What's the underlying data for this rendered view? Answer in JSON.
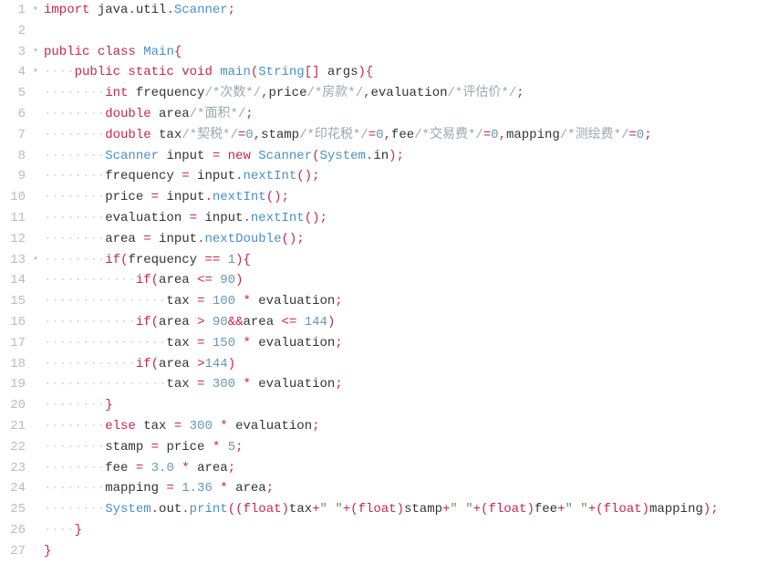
{
  "lines": [
    {
      "n": "1",
      "fold": "▾",
      "indent": 0,
      "tokens": [
        [
          "kw",
          "import"
        ],
        [
          "id",
          " java"
        ],
        [
          "op",
          "."
        ],
        [
          "id",
          "util"
        ],
        [
          "op",
          "."
        ],
        [
          "type",
          "Scanner"
        ],
        [
          "op",
          ";"
        ]
      ]
    },
    {
      "n": "2",
      "fold": "",
      "indent": 0,
      "tokens": []
    },
    {
      "n": "3",
      "fold": "▾",
      "indent": 0,
      "tokens": [
        [
          "kw",
          "public "
        ],
        [
          "kw",
          "class "
        ],
        [
          "type",
          "Main"
        ],
        [
          "op",
          "{"
        ]
      ]
    },
    {
      "n": "4",
      "fold": "▾",
      "indent": 1,
      "tokens": [
        [
          "kw",
          "public "
        ],
        [
          "kw",
          "static "
        ],
        [
          "kw",
          "void "
        ],
        [
          "func",
          "main"
        ],
        [
          "op",
          "("
        ],
        [
          "type",
          "String"
        ],
        [
          "op",
          "[] "
        ],
        [
          "id",
          "args"
        ],
        [
          "op",
          ")"
        ],
        [
          "op",
          "{"
        ]
      ]
    },
    {
      "n": "5",
      "fold": "",
      "indent": 2,
      "tokens": [
        [
          "kw",
          "int "
        ],
        [
          "id",
          "frequency"
        ],
        [
          "cmt",
          "/*次数*/"
        ],
        [
          "op",
          ","
        ],
        [
          "id",
          "price"
        ],
        [
          "cmt",
          "/*房款*/"
        ],
        [
          "op",
          ","
        ],
        [
          "id",
          "evaluation"
        ],
        [
          "cmt",
          "/*评估价*/"
        ],
        [
          "op",
          ";"
        ]
      ]
    },
    {
      "n": "6",
      "fold": "",
      "indent": 2,
      "tokens": [
        [
          "kw",
          "double "
        ],
        [
          "id",
          "area"
        ],
        [
          "cmt",
          "/*面积*/"
        ],
        [
          "op",
          ";"
        ]
      ]
    },
    {
      "n": "7",
      "fold": "",
      "indent": 2,
      "tokens": [
        [
          "kw",
          "double "
        ],
        [
          "id",
          "tax"
        ],
        [
          "cmt",
          "/*契税*/"
        ],
        [
          "op",
          "="
        ],
        [
          "num",
          "0"
        ],
        [
          "op",
          ","
        ],
        [
          "id",
          "stamp"
        ],
        [
          "cmt",
          "/*印花税*/"
        ],
        [
          "op",
          "="
        ],
        [
          "num",
          "0"
        ],
        [
          "op",
          ","
        ],
        [
          "id",
          "fee"
        ],
        [
          "cmt",
          "/*交易费*/"
        ],
        [
          "op",
          "="
        ],
        [
          "num",
          "0"
        ],
        [
          "op",
          ","
        ],
        [
          "id",
          "mapping"
        ],
        [
          "cmt",
          "/*测绘费*/"
        ],
        [
          "op",
          "="
        ],
        [
          "num",
          "0"
        ],
        [
          "op",
          ";"
        ]
      ]
    },
    {
      "n": "8",
      "fold": "",
      "indent": 2,
      "tokens": [
        [
          "type",
          "Scanner "
        ],
        [
          "id",
          "input "
        ],
        [
          "op",
          "= "
        ],
        [
          "kw",
          "new "
        ],
        [
          "type",
          "Scanner"
        ],
        [
          "op",
          "("
        ],
        [
          "type",
          "System"
        ],
        [
          "op",
          "."
        ],
        [
          "id",
          "in"
        ],
        [
          "op",
          ")"
        ],
        [
          "op",
          ";"
        ]
      ]
    },
    {
      "n": "9",
      "fold": "",
      "indent": 2,
      "tokens": [
        [
          "id",
          "frequency "
        ],
        [
          "op",
          "= "
        ],
        [
          "id",
          "input"
        ],
        [
          "op",
          "."
        ],
        [
          "func",
          "nextInt"
        ],
        [
          "op",
          "()"
        ],
        [
          "op",
          ";"
        ]
      ]
    },
    {
      "n": "10",
      "fold": "",
      "indent": 2,
      "tokens": [
        [
          "id",
          "price "
        ],
        [
          "op",
          "= "
        ],
        [
          "id",
          "input"
        ],
        [
          "op",
          "."
        ],
        [
          "func",
          "nextInt"
        ],
        [
          "op",
          "()"
        ],
        [
          "op",
          ";"
        ]
      ]
    },
    {
      "n": "11",
      "fold": "",
      "indent": 2,
      "tokens": [
        [
          "id",
          "evaluation "
        ],
        [
          "op",
          "= "
        ],
        [
          "id",
          "input"
        ],
        [
          "op",
          "."
        ],
        [
          "func",
          "nextInt"
        ],
        [
          "op",
          "()"
        ],
        [
          "op",
          ";"
        ]
      ]
    },
    {
      "n": "12",
      "fold": "",
      "indent": 2,
      "tokens": [
        [
          "id",
          "area "
        ],
        [
          "op",
          "= "
        ],
        [
          "id",
          "input"
        ],
        [
          "op",
          "."
        ],
        [
          "func",
          "nextDouble"
        ],
        [
          "op",
          "()"
        ],
        [
          "op",
          ";"
        ]
      ]
    },
    {
      "n": "13",
      "fold": "▾",
      "indent": 2,
      "tokens": [
        [
          "kw",
          "if"
        ],
        [
          "op",
          "("
        ],
        [
          "id",
          "frequency "
        ],
        [
          "op",
          "== "
        ],
        [
          "num",
          "1"
        ],
        [
          "op",
          ")"
        ],
        [
          "op",
          "{"
        ]
      ]
    },
    {
      "n": "14",
      "fold": "",
      "indent": 3,
      "tokens": [
        [
          "kw",
          "if"
        ],
        [
          "op",
          "("
        ],
        [
          "id",
          "area "
        ],
        [
          "op",
          "<= "
        ],
        [
          "num",
          "90"
        ],
        [
          "op",
          ")"
        ]
      ]
    },
    {
      "n": "15",
      "fold": "",
      "indent": 4,
      "tokens": [
        [
          "id",
          "tax "
        ],
        [
          "op",
          "= "
        ],
        [
          "num",
          "100"
        ],
        [
          "op",
          " * "
        ],
        [
          "id",
          "evaluation"
        ],
        [
          "op",
          ";"
        ]
      ]
    },
    {
      "n": "16",
      "fold": "",
      "indent": 3,
      "tokens": [
        [
          "kw",
          "if"
        ],
        [
          "op",
          "("
        ],
        [
          "id",
          "area "
        ],
        [
          "op",
          "> "
        ],
        [
          "num",
          "90"
        ],
        [
          "op",
          "&&"
        ],
        [
          "id",
          "area "
        ],
        [
          "op",
          "<= "
        ],
        [
          "num",
          "144"
        ],
        [
          "op",
          ")"
        ]
      ]
    },
    {
      "n": "17",
      "fold": "",
      "indent": 4,
      "tokens": [
        [
          "id",
          "tax "
        ],
        [
          "op",
          "= "
        ],
        [
          "num",
          "150"
        ],
        [
          "op",
          " * "
        ],
        [
          "id",
          "evaluation"
        ],
        [
          "op",
          ";"
        ]
      ]
    },
    {
      "n": "18",
      "fold": "",
      "indent": 3,
      "tokens": [
        [
          "kw",
          "if"
        ],
        [
          "op",
          "("
        ],
        [
          "id",
          "area "
        ],
        [
          "op",
          ">"
        ],
        [
          "num",
          "144"
        ],
        [
          "op",
          ")"
        ]
      ]
    },
    {
      "n": "19",
      "fold": "",
      "indent": 4,
      "tokens": [
        [
          "id",
          "tax "
        ],
        [
          "op",
          "= "
        ],
        [
          "num",
          "300"
        ],
        [
          "op",
          " * "
        ],
        [
          "id",
          "evaluation"
        ],
        [
          "op",
          ";"
        ]
      ]
    },
    {
      "n": "20",
      "fold": "",
      "indent": 2,
      "tokens": [
        [
          "op",
          "}"
        ]
      ]
    },
    {
      "n": "21",
      "fold": "",
      "indent": 2,
      "tokens": [
        [
          "kw",
          "else "
        ],
        [
          "id",
          "tax "
        ],
        [
          "op",
          "= "
        ],
        [
          "num",
          "300"
        ],
        [
          "op",
          " * "
        ],
        [
          "id",
          "evaluation"
        ],
        [
          "op",
          ";"
        ]
      ]
    },
    {
      "n": "22",
      "fold": "",
      "indent": 2,
      "tokens": [
        [
          "id",
          "stamp "
        ],
        [
          "op",
          "= "
        ],
        [
          "id",
          "price "
        ],
        [
          "op",
          "* "
        ],
        [
          "num",
          "5"
        ],
        [
          "op",
          ";"
        ]
      ]
    },
    {
      "n": "23",
      "fold": "",
      "indent": 2,
      "tokens": [
        [
          "id",
          "fee "
        ],
        [
          "op",
          "= "
        ],
        [
          "num",
          "3.0"
        ],
        [
          "op",
          " * "
        ],
        [
          "id",
          "area"
        ],
        [
          "op",
          ";"
        ]
      ]
    },
    {
      "n": "24",
      "fold": "",
      "indent": 2,
      "tokens": [
        [
          "id",
          "mapping "
        ],
        [
          "op",
          "= "
        ],
        [
          "num",
          "1.36"
        ],
        [
          "op",
          " * "
        ],
        [
          "id",
          "area"
        ],
        [
          "op",
          ";"
        ]
      ]
    },
    {
      "n": "25",
      "fold": "",
      "indent": 2,
      "tokens": [
        [
          "type",
          "System"
        ],
        [
          "op",
          "."
        ],
        [
          "id",
          "out"
        ],
        [
          "op",
          "."
        ],
        [
          "func",
          "print"
        ],
        [
          "op",
          "(("
        ],
        [
          "kw",
          "float"
        ],
        [
          "op",
          ")"
        ],
        [
          "id",
          "tax"
        ],
        [
          "op",
          "+"
        ],
        [
          "str",
          "\" \""
        ],
        [
          "op",
          "+("
        ],
        [
          "kw",
          "float"
        ],
        [
          "op",
          ")"
        ],
        [
          "id",
          "stamp"
        ],
        [
          "op",
          "+"
        ],
        [
          "str",
          "\" \""
        ],
        [
          "op",
          "+("
        ],
        [
          "kw",
          "float"
        ],
        [
          "op",
          ")"
        ],
        [
          "id",
          "fee"
        ],
        [
          "op",
          "+"
        ],
        [
          "str",
          "\" \""
        ],
        [
          "op",
          "+("
        ],
        [
          "kw",
          "float"
        ],
        [
          "op",
          ")"
        ],
        [
          "id",
          "mapping"
        ],
        [
          "op",
          ");"
        ]
      ]
    },
    {
      "n": "26",
      "fold": "",
      "indent": 1,
      "tokens": [
        [
          "op",
          "}"
        ]
      ]
    },
    {
      "n": "27",
      "fold": "",
      "indent": 0,
      "tokens": [
        [
          "op",
          "}"
        ]
      ]
    }
  ],
  "indentUnit": "····"
}
